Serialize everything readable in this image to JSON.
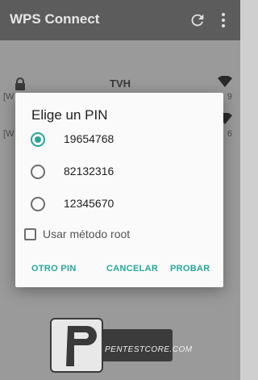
{
  "app": {
    "title": "WPS Connect"
  },
  "networks": [
    {
      "ssid": "TVH",
      "sub": "[W",
      "channel": "9",
      "locked": true
    },
    {
      "ssid": "",
      "sub": "[W",
      "channel": "6",
      "locked": false
    }
  ],
  "dialog": {
    "title": "Elige un PIN",
    "options": [
      {
        "label": "19654768",
        "checked": true
      },
      {
        "label": "82132316",
        "checked": false
      },
      {
        "label": "12345670",
        "checked": false
      }
    ],
    "root_label": "Usar método root",
    "root_checked": false,
    "buttons": {
      "other": "OTRO PIN",
      "cancel": "CANCELAR",
      "try": "PROBAR"
    }
  },
  "watermark": {
    "text": "PENTESTCORE.COM"
  },
  "colors": {
    "accent": "#26a69a",
    "appbar": "#5c5c5c"
  }
}
